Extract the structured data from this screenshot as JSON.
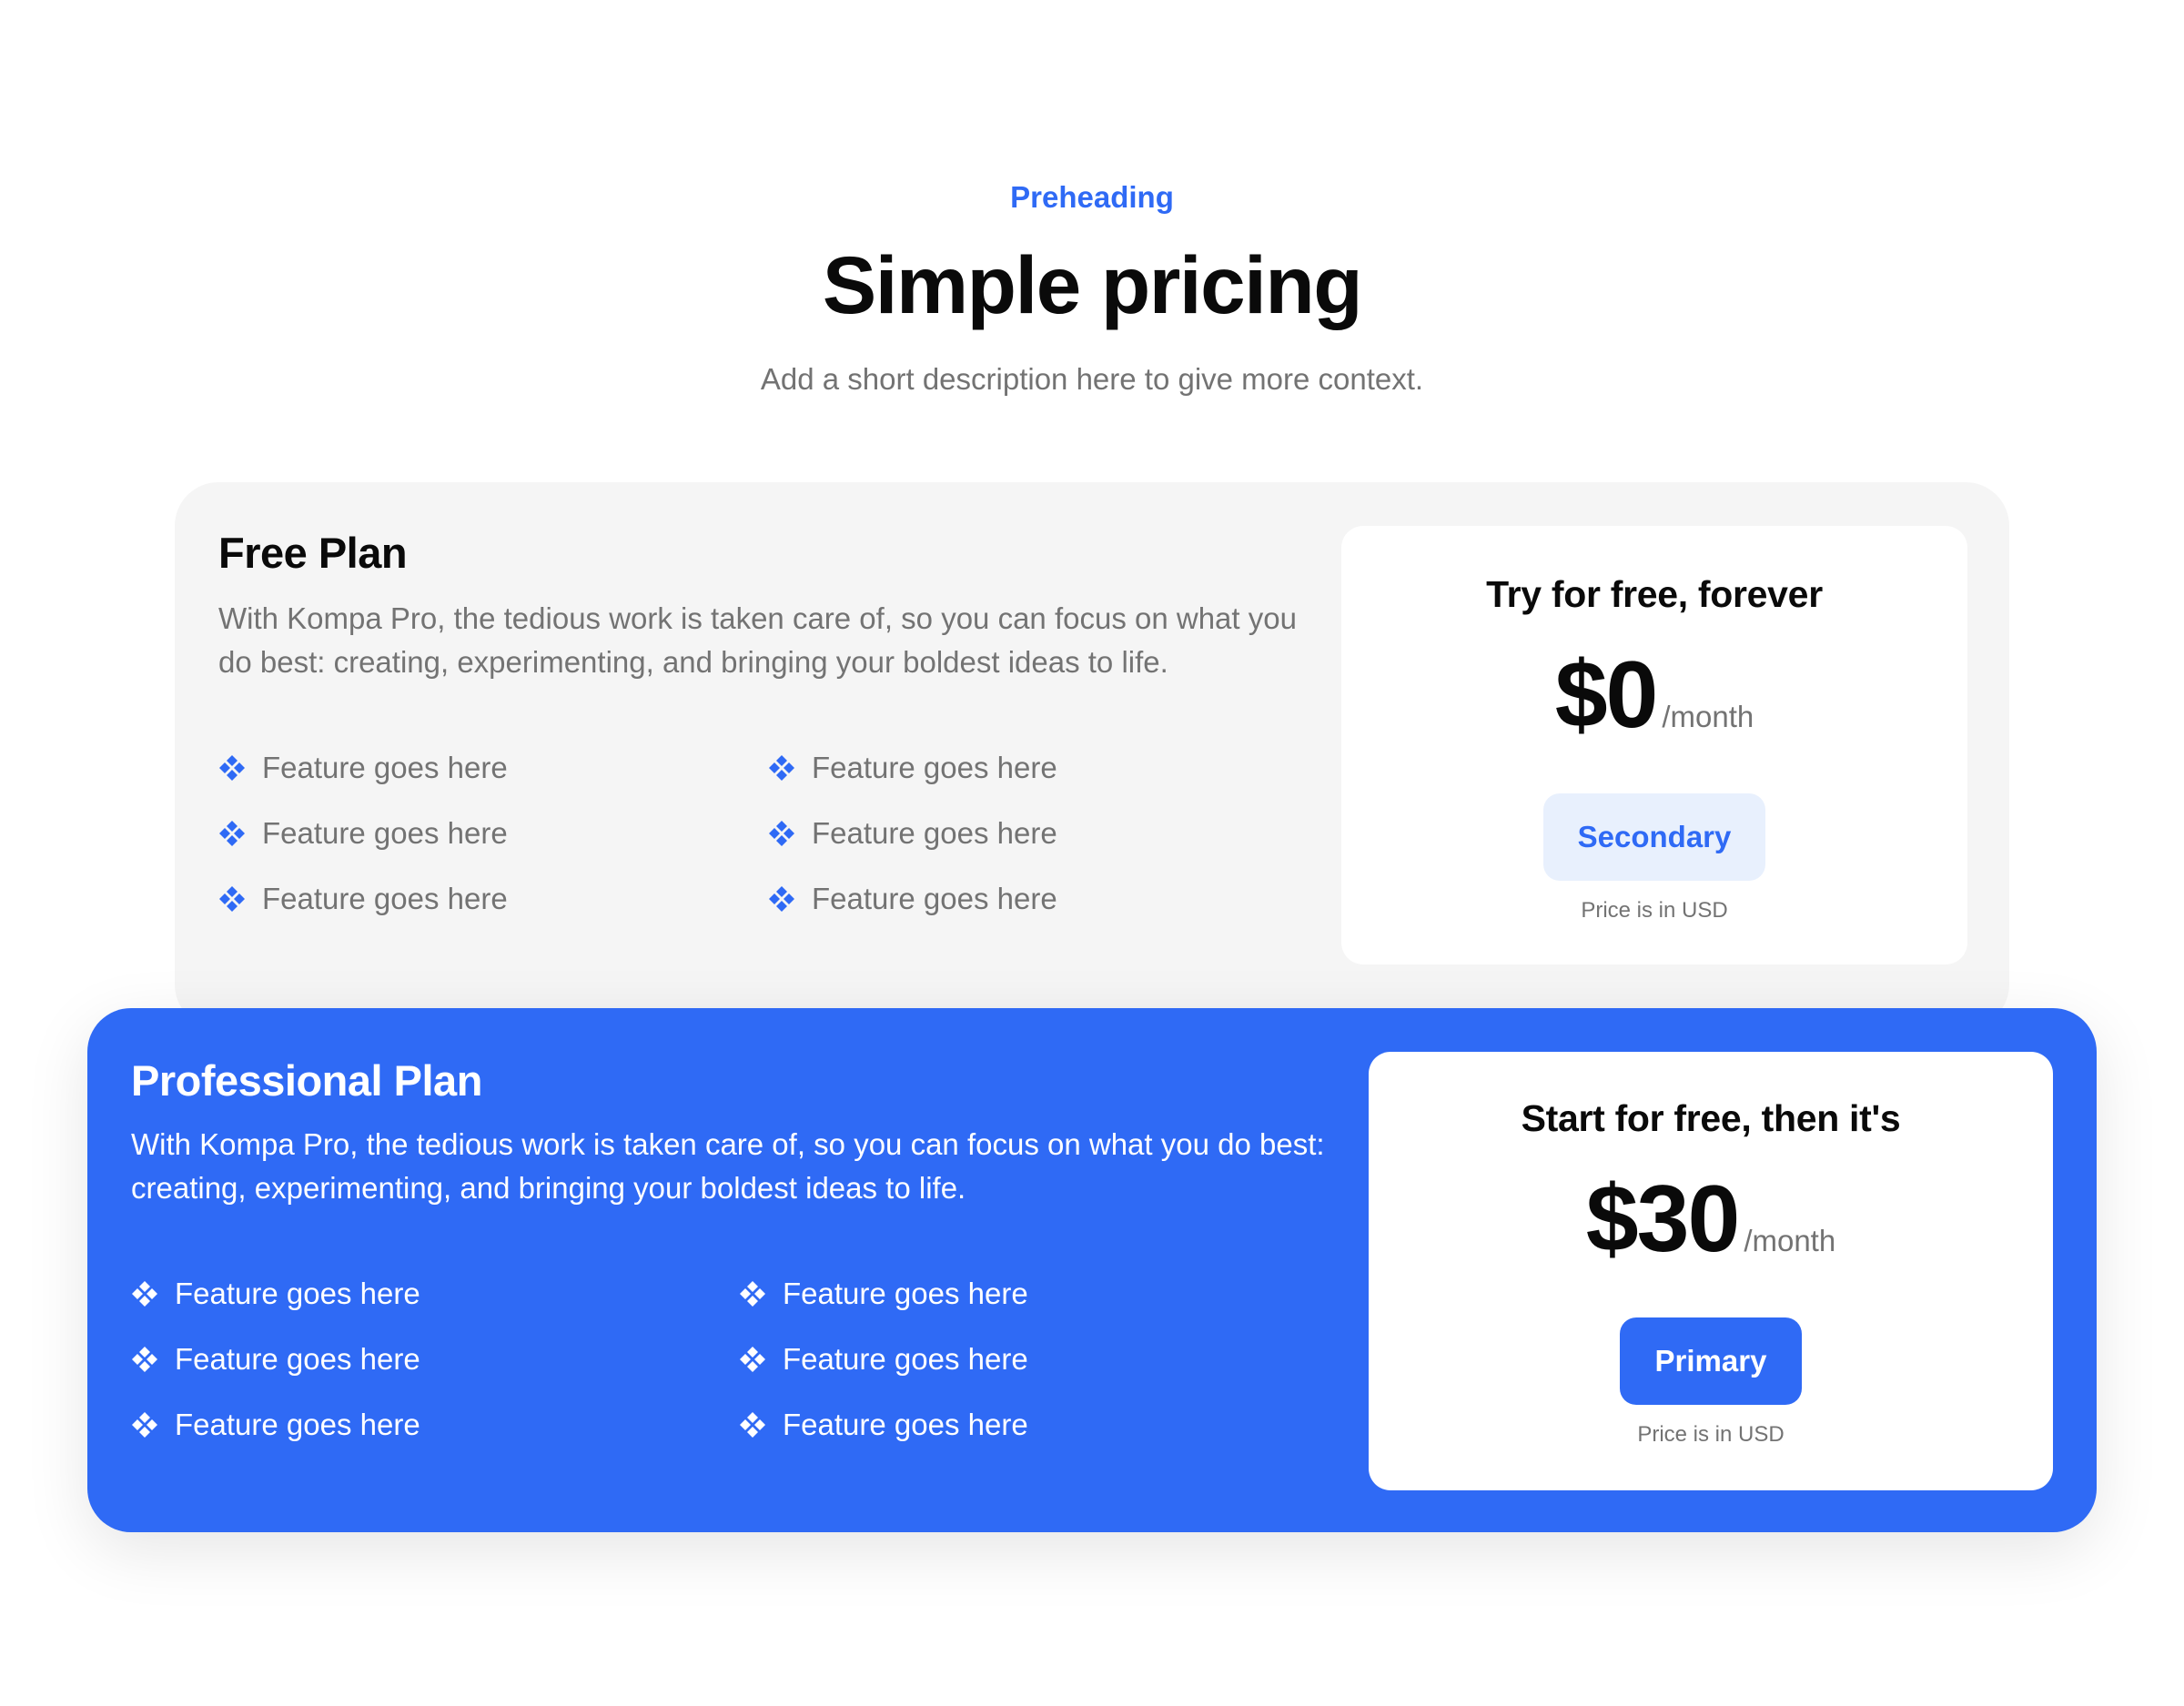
{
  "header": {
    "preheading": "Preheading",
    "title": "Simple pricing",
    "subtitle": "Add a short description here to give more context."
  },
  "plans": [
    {
      "name": "Free Plan",
      "description": "With Kompa Pro, the tedious work is taken care of, so you can focus on what you do best: creating, experimenting, and bringing your boldest ideas to life.",
      "features": [
        "Feature goes here",
        "Feature goes here",
        "Feature goes here",
        "Feature goes here",
        "Feature goes here",
        "Feature goes here"
      ],
      "price_heading": "Try for free, forever",
      "price": "$0",
      "period": "/month",
      "button_label": "Secondary",
      "note": "Price is in USD"
    },
    {
      "name": "Professional Plan",
      "description": "With Kompa Pro, the tedious work is taken care of, so you can focus on what you do best: creating, experimenting, and bringing your boldest ideas to life.",
      "features": [
        "Feature goes here",
        "Feature goes here",
        "Feature goes here",
        "Feature goes here",
        "Feature goes here",
        "Feature goes here"
      ],
      "price_heading": "Start for free, then it's",
      "price": "$30",
      "period": "/month",
      "button_label": "Primary",
      "note": "Price is in USD"
    }
  ],
  "colors": {
    "accent": "#2f6af5",
    "muted_text": "#737373",
    "card_bg": "#f5f5f5"
  },
  "icons": {
    "feature": "diamond-cluster-icon"
  }
}
